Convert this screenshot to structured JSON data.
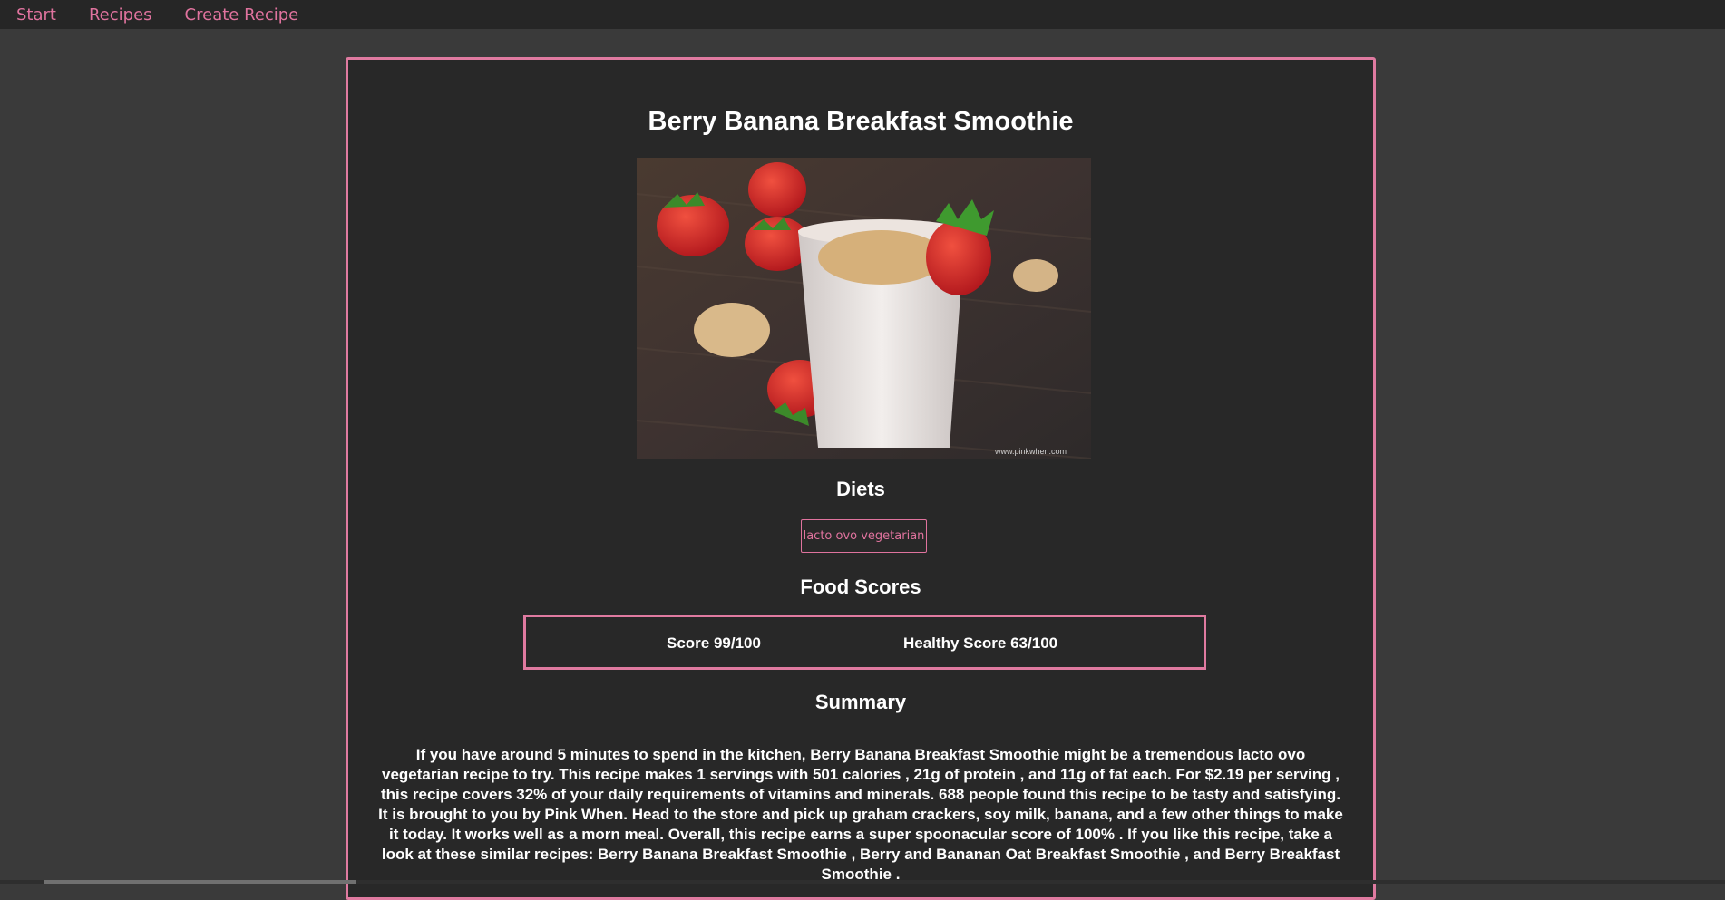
{
  "nav": {
    "items": [
      {
        "label": "Start"
      },
      {
        "label": "Recipes"
      },
      {
        "label": "Create Recipe"
      }
    ]
  },
  "colors": {
    "accent": "#e0739e",
    "background": "#3a3a3a",
    "card": "#282828",
    "nav": "#262626"
  },
  "recipe": {
    "title": "Berry Banana Breakfast Smoothie",
    "image_alt": "smoothie-photo",
    "diets_heading": "Diets",
    "diets": [
      "lacto ovo vegetarian"
    ],
    "food_scores_heading": "Food Scores",
    "score_label": "Score 99/100",
    "healthy_score_label": "Healthy Score 63/100",
    "summary_heading": "Summary",
    "summary": "If you have around 5 minutes to spend in the kitchen, Berry Banana Breakfast Smoothie might be a tremendous lacto ovo vegetarian recipe to try. This recipe makes 1 servings with 501 calories , 21g of protein , and 11g of fat each. For $2.19 per serving , this recipe covers 32% of your daily requirements of vitamins and minerals. 688 people found this recipe to be tasty and satisfying. It is brought to you by Pink When. Head to the store and pick up graham crackers, soy milk, banana, and a few other things to make it today. It works well as a morn meal. Overall, this recipe earns a super spoonacular score of 100% . If you like this recipe, take a look at these similar recipes: Berry Banana Breakfast Smoothie , Berry and Bananan Oat Breakfast Smoothie , and Berry Breakfast Smoothie .",
    "photo_watermark": "www.pinkwhen.com"
  }
}
